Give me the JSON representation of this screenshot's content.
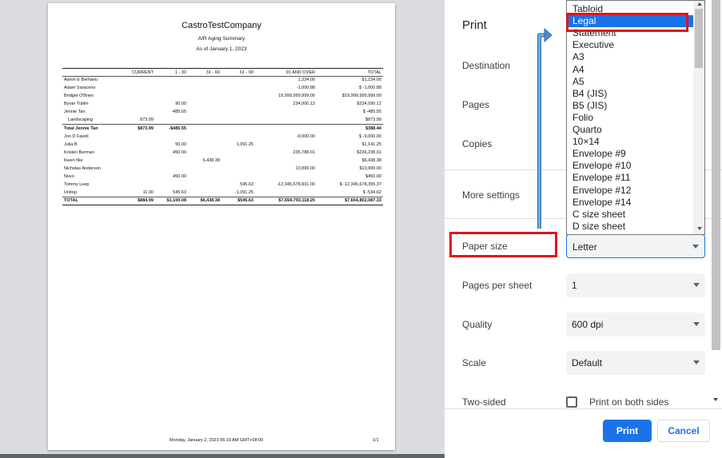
{
  "report": {
    "company": "CastroTestCompany",
    "title": "A/R Aging Summary",
    "as_of": "As of January 1, 2023",
    "columns": [
      "",
      "CURRENT",
      "1 - 30",
      "31 - 60",
      "61 - 90",
      "91 AND OVER",
      "TOTAL"
    ],
    "rows": [
      {
        "name": "Aaron E Berhanu",
        "current": "",
        "d1_30": "",
        "d31_60": "",
        "d61_90": "",
        "d91": "1,234.00",
        "total": "$1,234.00"
      },
      {
        "name": "Adam Saraceno",
        "current": "",
        "d1_30": "",
        "d31_60": "",
        "d61_90": "",
        "d91": "-1,000.88",
        "total": "$ -1,000.88"
      },
      {
        "name": "Bridget O'Brien",
        "current": "",
        "d1_30": "",
        "d31_60": "",
        "d61_90": "",
        "d91": "19,999,999,999.00",
        "total": "$19,999,999,999.00"
      },
      {
        "name": "Byran Tublin",
        "current": "",
        "d1_30": "90.00",
        "d31_60": "",
        "d61_90": "",
        "d91": "234,000.12",
        "total": "$234,090.12"
      },
      {
        "name": "Jennie Tan",
        "current": "",
        "d1_30": "-485.55",
        "d31_60": "",
        "d61_90": "",
        "d91": "",
        "total": "$ -485.55"
      },
      {
        "name": "Landscaping",
        "current": "873.99",
        "d1_30": "",
        "d31_60": "",
        "d61_90": "",
        "d91": "",
        "total": "$873.99",
        "style": "sub"
      },
      {
        "name": "Total Jennie Tan",
        "current": "$873.99",
        "d1_30": "-$485.55",
        "d31_60": "",
        "d61_90": "",
        "d91": "",
        "total": "$388.44",
        "style": "subtotal"
      },
      {
        "name": "Jon D Fasoli",
        "current": "",
        "d1_30": "",
        "d31_60": "",
        "d61_90": "",
        "d91": "-9,000.00",
        "total": "$ -9,000.00"
      },
      {
        "name": "Julia B",
        "current": "",
        "d1_30": "50.00",
        "d31_60": "",
        "d61_90": "1,091.25",
        "d91": "",
        "total": "$1,141.25"
      },
      {
        "name": "Kristen Berman",
        "current": "",
        "d1_30": "450.00",
        "d31_60": "",
        "d61_90": "",
        "d91": "235,788.01",
        "total": "$236,238.01"
      },
      {
        "name": "Kwen Nie",
        "current": "",
        "d1_30": "",
        "d31_60": "6,438.38",
        "d61_90": "",
        "d91": "",
        "total": "$6,438.38"
      },
      {
        "name": "Nicholas Anderson",
        "current": "",
        "d1_30": "",
        "d31_60": "",
        "d61_90": "",
        "d91": "10,999.00",
        "total": "$10,999.00"
      },
      {
        "name": "Novo",
        "current": "",
        "d1_30": "450.00",
        "d31_60": "",
        "d61_90": "",
        "d91": "",
        "total": "$450.00"
      },
      {
        "name": "Tommy Leep",
        "current": "",
        "d1_30": "",
        "d31_60": "",
        "d61_90": "545.63",
        "d91": "-12,345,678,901.00",
        "total": "$ -12,345,678,355.37"
      },
      {
        "name": "Unitop",
        "current": "11.00",
        "d1_30": "545.63",
        "d31_60": "",
        "d61_90": "-1,091.25",
        "d91": "",
        "total": "$ -534.62"
      },
      {
        "name": "TOTAL",
        "current": "$884.99",
        "d1_30": "$1,100.08",
        "d31_60": "$6,438.38",
        "d61_90": "$545.63",
        "d91": "$7,654,793,118.25",
        "total": "$7,654,802,087.33",
        "style": "total"
      }
    ],
    "footer": "Monday, January 2, 2023 06:19 AM GMT+08:00",
    "page_number": "1/1"
  },
  "settings": {
    "title": "Print",
    "destination_label": "Destination",
    "pages_label": "Pages",
    "copies_label": "Copies",
    "more_settings_label": "More settings",
    "paper_size_label": "Paper size",
    "paper_size_value": "Letter",
    "pages_per_sheet_label": "Pages per sheet",
    "pages_per_sheet_value": "1",
    "quality_label": "Quality",
    "quality_value": "600 dpi",
    "scale_label": "Scale",
    "scale_value": "Default",
    "two_sided_label": "Two-sided",
    "two_sided_option": "Print on both sides",
    "print_button": "Print",
    "cancel_button": "Cancel"
  },
  "paper_dropdown": {
    "options": [
      "Letter",
      "Tabloid",
      "Legal",
      "Statement",
      "Executive",
      "A3",
      "A4",
      "A5",
      "B4 (JIS)",
      "B5 (JIS)",
      "Folio",
      "Quarto",
      "10×14",
      "Envelope #9",
      "Envelope #10",
      "Envelope #11",
      "Envelope #12",
      "Envelope #14",
      "C size sheet",
      "D size sheet"
    ],
    "highlighted": "Legal"
  },
  "colors": {
    "accent": "#1a73e8",
    "annotation": "#e0141b"
  }
}
